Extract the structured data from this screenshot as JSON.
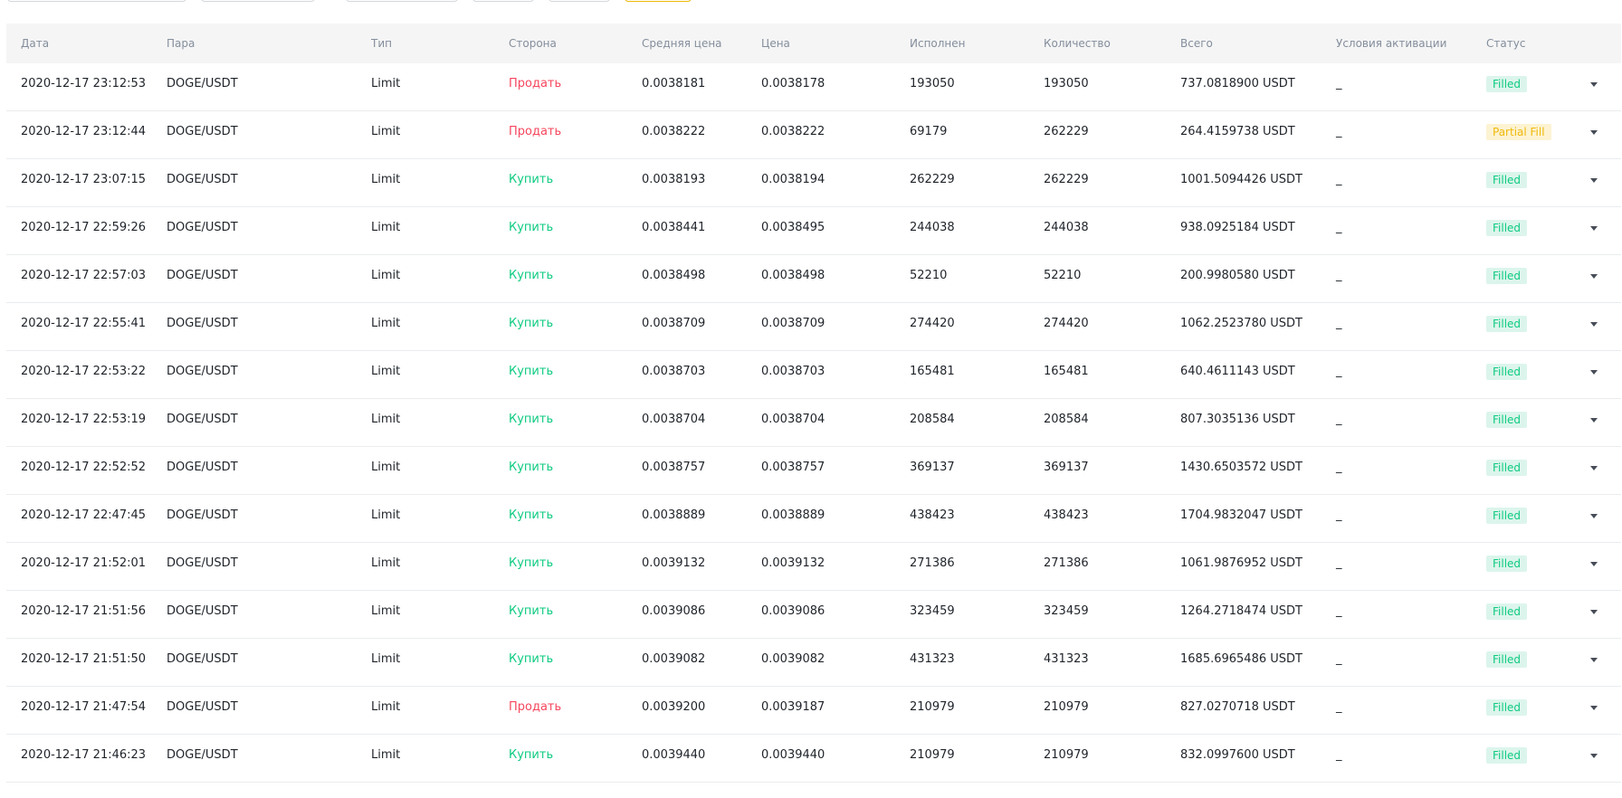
{
  "columns": {
    "date": "Дата",
    "pair": "Пара",
    "type": "Тип",
    "side": "Сторона",
    "avg_price": "Средняя цена",
    "price": "Цена",
    "executed": "Исполнен",
    "amount": "Количество",
    "total": "Всего",
    "trigger": "Условия активации",
    "status": "Статус"
  },
  "rows": [
    {
      "date": "2020-12-17 23:12:53",
      "pair": "DOGE/USDT",
      "type": "Limit",
      "side": "Продать",
      "side_kind": "sell",
      "avg_price": "0.0038181",
      "price": "0.0038178",
      "executed": "193050",
      "amount": "193050",
      "total": "737.0818900 USDT",
      "trigger": "_",
      "status": "Filled",
      "status_kind": "filled"
    },
    {
      "date": "2020-12-17 23:12:44",
      "pair": "DOGE/USDT",
      "type": "Limit",
      "side": "Продать",
      "side_kind": "sell",
      "avg_price": "0.0038222",
      "price": "0.0038222",
      "executed": "69179",
      "amount": "262229",
      "total": "264.4159738 USDT",
      "trigger": "_",
      "status": "Partial Fill",
      "status_kind": "partial"
    },
    {
      "date": "2020-12-17 23:07:15",
      "pair": "DOGE/USDT",
      "type": "Limit",
      "side": "Купить",
      "side_kind": "buy",
      "avg_price": "0.0038193",
      "price": "0.0038194",
      "executed": "262229",
      "amount": "262229",
      "total": "1001.5094426 USDT",
      "trigger": "_",
      "status": "Filled",
      "status_kind": "filled"
    },
    {
      "date": "2020-12-17 22:59:26",
      "pair": "DOGE/USDT",
      "type": "Limit",
      "side": "Купить",
      "side_kind": "buy",
      "avg_price": "0.0038441",
      "price": "0.0038495",
      "executed": "244038",
      "amount": "244038",
      "total": "938.0925184 USDT",
      "trigger": "_",
      "status": "Filled",
      "status_kind": "filled"
    },
    {
      "date": "2020-12-17 22:57:03",
      "pair": "DOGE/USDT",
      "type": "Limit",
      "side": "Купить",
      "side_kind": "buy",
      "avg_price": "0.0038498",
      "price": "0.0038498",
      "executed": "52210",
      "amount": "52210",
      "total": "200.9980580 USDT",
      "trigger": "_",
      "status": "Filled",
      "status_kind": "filled"
    },
    {
      "date": "2020-12-17 22:55:41",
      "pair": "DOGE/USDT",
      "type": "Limit",
      "side": "Купить",
      "side_kind": "buy",
      "avg_price": "0.0038709",
      "price": "0.0038709",
      "executed": "274420",
      "amount": "274420",
      "total": "1062.2523780 USDT",
      "trigger": "_",
      "status": "Filled",
      "status_kind": "filled"
    },
    {
      "date": "2020-12-17 22:53:22",
      "pair": "DOGE/USDT",
      "type": "Limit",
      "side": "Купить",
      "side_kind": "buy",
      "avg_price": "0.0038703",
      "price": "0.0038703",
      "executed": "165481",
      "amount": "165481",
      "total": "640.4611143 USDT",
      "trigger": "_",
      "status": "Filled",
      "status_kind": "filled"
    },
    {
      "date": "2020-12-17 22:53:19",
      "pair": "DOGE/USDT",
      "type": "Limit",
      "side": "Купить",
      "side_kind": "buy",
      "avg_price": "0.0038704",
      "price": "0.0038704",
      "executed": "208584",
      "amount": "208584",
      "total": "807.3035136 USDT",
      "trigger": "_",
      "status": "Filled",
      "status_kind": "filled"
    },
    {
      "date": "2020-12-17 22:52:52",
      "pair": "DOGE/USDT",
      "type": "Limit",
      "side": "Купить",
      "side_kind": "buy",
      "avg_price": "0.0038757",
      "price": "0.0038757",
      "executed": "369137",
      "amount": "369137",
      "total": "1430.6503572 USDT",
      "trigger": "_",
      "status": "Filled",
      "status_kind": "filled"
    },
    {
      "date": "2020-12-17 22:47:45",
      "pair": "DOGE/USDT",
      "type": "Limit",
      "side": "Купить",
      "side_kind": "buy",
      "avg_price": "0.0038889",
      "price": "0.0038889",
      "executed": "438423",
      "amount": "438423",
      "total": "1704.9832047 USDT",
      "trigger": "_",
      "status": "Filled",
      "status_kind": "filled"
    },
    {
      "date": "2020-12-17 21:52:01",
      "pair": "DOGE/USDT",
      "type": "Limit",
      "side": "Купить",
      "side_kind": "buy",
      "avg_price": "0.0039132",
      "price": "0.0039132",
      "executed": "271386",
      "amount": "271386",
      "total": "1061.9876952 USDT",
      "trigger": "_",
      "status": "Filled",
      "status_kind": "filled"
    },
    {
      "date": "2020-12-17 21:51:56",
      "pair": "DOGE/USDT",
      "type": "Limit",
      "side": "Купить",
      "side_kind": "buy",
      "avg_price": "0.0039086",
      "price": "0.0039086",
      "executed": "323459",
      "amount": "323459",
      "total": "1264.2718474 USDT",
      "trigger": "_",
      "status": "Filled",
      "status_kind": "filled"
    },
    {
      "date": "2020-12-17 21:51:50",
      "pair": "DOGE/USDT",
      "type": "Limit",
      "side": "Купить",
      "side_kind": "buy",
      "avg_price": "0.0039082",
      "price": "0.0039082",
      "executed": "431323",
      "amount": "431323",
      "total": "1685.6965486 USDT",
      "trigger": "_",
      "status": "Filled",
      "status_kind": "filled"
    },
    {
      "date": "2020-12-17 21:47:54",
      "pair": "DOGE/USDT",
      "type": "Limit",
      "side": "Продать",
      "side_kind": "sell",
      "avg_price": "0.0039200",
      "price": "0.0039187",
      "executed": "210979",
      "amount": "210979",
      "total": "827.0270718 USDT",
      "trigger": "_",
      "status": "Filled",
      "status_kind": "filled"
    },
    {
      "date": "2020-12-17 21:46:23",
      "pair": "DOGE/USDT",
      "type": "Limit",
      "side": "Купить",
      "side_kind": "buy",
      "avg_price": "0.0039440",
      "price": "0.0039440",
      "executed": "210979",
      "amount": "210979",
      "total": "832.0997600 USDT",
      "trigger": "_",
      "status": "Filled",
      "status_kind": "filled"
    }
  ],
  "row_action_icon": "chevron-down-icon",
  "colors": {
    "sell": "#f6465d",
    "buy": "#0ecb81",
    "filled_bg": "#dcf5ec",
    "partial_bg": "#fdf3d2",
    "accent": "#f0b90b",
    "header_bg": "#f5f5f5"
  }
}
